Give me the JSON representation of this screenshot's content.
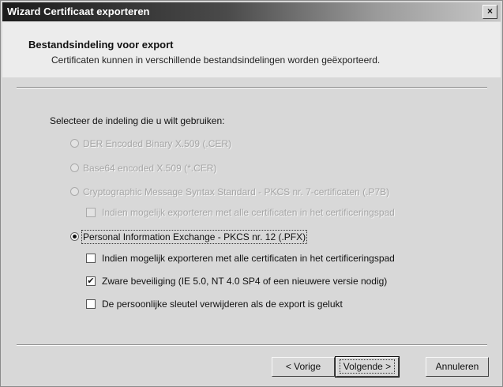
{
  "window": {
    "title": "Wizard Certificaat exporteren",
    "close_glyph": "×"
  },
  "header": {
    "title": "Bestandsindeling voor export",
    "subtitle": "Certificaten kunnen in verschillende bestandsindelingen worden geëxporteerd."
  },
  "prompt": "Selecteer de indeling die u wilt gebruiken:",
  "options": [
    {
      "label": "DER Encoded Binary X.509 (.CER)",
      "enabled": false,
      "selected": false
    },
    {
      "label": "Base64 encoded X.509 (*.CER)",
      "enabled": false,
      "selected": false
    },
    {
      "label": "Cryptographic Message Syntax Standard - PKCS nr. 7-certificaten (.P7B)",
      "enabled": false,
      "selected": false
    },
    {
      "label": "Personal Information Exchange - PKCS nr. 12 (.PFX)",
      "enabled": true,
      "selected": true
    }
  ],
  "p7b_checkbox": {
    "label": "Indien mogelijk exporteren met alle certificaten in het certificeringspad",
    "checked": false,
    "enabled": false
  },
  "pfx_checkboxes": [
    {
      "label": "Indien mogelijk exporteren met alle certificaten in het certificeringspad",
      "checked": false
    },
    {
      "label": "Zware beveiliging (IE 5.0, NT 4.0 SP4 of een nieuwere versie nodig)",
      "checked": true
    },
    {
      "label": "De persoonlijke sleutel verwijderen als de export is gelukt",
      "checked": false
    }
  ],
  "buttons": {
    "back": "< Vorige",
    "next": "Volgende >",
    "cancel": "Annuleren"
  }
}
